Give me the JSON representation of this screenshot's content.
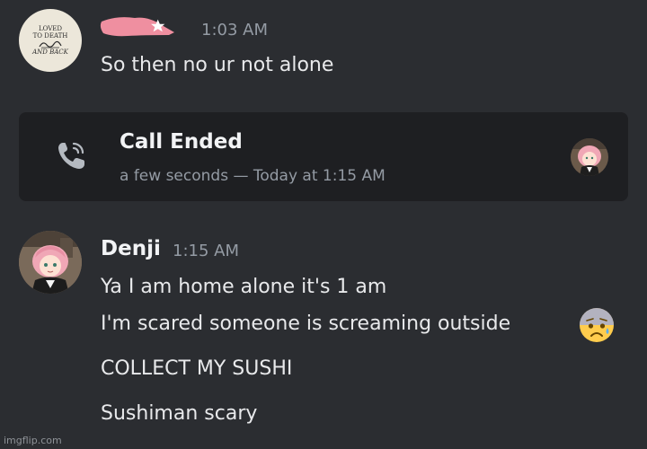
{
  "messages": [
    {
      "author_redacted": true,
      "timestamp": "1:03 AM",
      "avatar": {
        "icon": "loved-to-death-logo-avatar",
        "text_lines": [
          "LOVED",
          "TO DEATH",
          "AND BACK"
        ]
      },
      "lines": [
        "So then no ur not alone"
      ]
    },
    {
      "author": "Denji",
      "timestamp": "1:15 AM",
      "avatar": {
        "icon": "anime-girl-avatar"
      },
      "lines": [
        "Ya I am home alone it's 1 am",
        "I'm scared someone is screaming outside",
        "COLLECT MY SUSHI",
        "Sushiman scary"
      ],
      "emoji": "anxious-face-with-sweat-emoji"
    }
  ],
  "call": {
    "title": "Call Ended",
    "subtitle": "a few seconds — Today at 1:15 AM",
    "icon": "phone-call-icon"
  },
  "watermark": "imgflip.com",
  "colors": {
    "background": "#2b2d31",
    "card": "#1e1f22",
    "redaction": "#ef8fa0",
    "muted_text": "#949ba4"
  }
}
